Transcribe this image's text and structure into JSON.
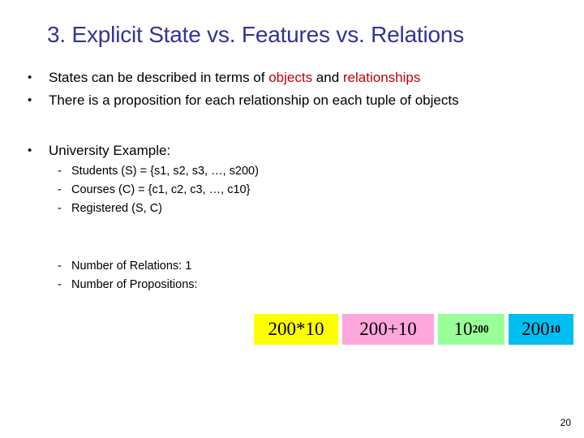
{
  "slide": {
    "title": "3. Explicit State vs. Features vs. Relations",
    "title_color": "#333399",
    "accent_red": "#C00000",
    "page_number": "20"
  },
  "bullets": [
    {
      "marker": "•",
      "segments": [
        {
          "text": "States can be described in terms of ",
          "style": "normal"
        },
        {
          "text": "objects",
          "style": "red"
        },
        {
          "text": " and ",
          "style": "normal"
        },
        {
          "text": "relationships",
          "style": "red"
        }
      ]
    },
    {
      "marker": "•",
      "segments": [
        {
          "text": "There is a proposition for each relationship on each tuple of objects",
          "style": "normal"
        }
      ]
    },
    {
      "marker": "•",
      "segments": [
        {
          "text": "University Example:",
          "style": "normal"
        }
      ]
    }
  ],
  "sub_bullets_group_1": [
    {
      "marker": "-",
      "text": "Students (S) = {s1, s2, s3, …, s200)"
    },
    {
      "marker": "-",
      "text": "Courses (C) = {c1, c2, c3, …, c10}"
    },
    {
      "marker": "-",
      "text": "Registered (S, C)"
    }
  ],
  "sub_bullets_group_2": [
    {
      "marker": "-",
      "text": "Number of Relations: 1"
    },
    {
      "marker": "-",
      "text": "Number of Propositions:"
    }
  ],
  "expression_boxes": [
    {
      "base": "200*10",
      "exponent": "",
      "bg": "#FFFF00",
      "name": "yellow"
    },
    {
      "base": "200+10",
      "exponent": "",
      "bg": "#FFA6DC",
      "name": "pink"
    },
    {
      "base": "10",
      "exponent": "200",
      "bg": "#99FF99",
      "name": "green"
    },
    {
      "base": "200",
      "exponent": "10",
      "bg": "#00BFF0",
      "name": "cyan"
    }
  ]
}
